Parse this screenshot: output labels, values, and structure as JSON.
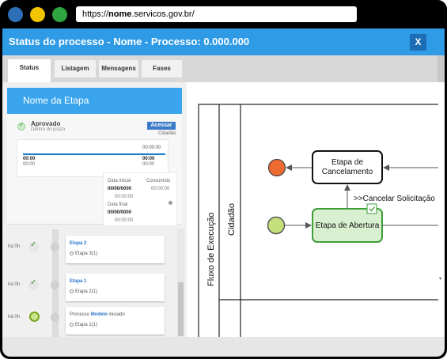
{
  "browser": {
    "url_prefix": "https://",
    "url_domain": "nome",
    "url_suffix": ".servicos.gov.br/"
  },
  "modal": {
    "title": "Status do processo - Nome - Processo: 0.000.000",
    "close_label": "X"
  },
  "tabs": [
    {
      "label": "Status",
      "active": true
    },
    {
      "label": "Listagem",
      "active": false
    },
    {
      "label": "Mensagens",
      "active": false
    },
    {
      "label": "Fases",
      "active": false
    }
  ],
  "stage": {
    "title": "Nome da Etapa",
    "status": "Aprovado",
    "status_detail": "Dentro do prazo",
    "access_button": "Acessar",
    "responsible": "Cidadão",
    "timeline": {
      "top_time": "00:00:00",
      "left_value": "00:00",
      "left_sub": "00:00",
      "right_value": "00:00",
      "right_sub": "00:00"
    },
    "dates": {
      "start_label": "Data inicial",
      "start_value": "00/00/0000",
      "start_time": "00:00:00",
      "consumed_label": "Consumido",
      "consumed_value": "00:00:00",
      "end_label": "Data final",
      "end_value": "00/00/0000",
      "end_time": "00:00:00"
    }
  },
  "history": [
    {
      "time": "há 0h",
      "title": "Etapa 2",
      "sub": "Etapa 3(1)",
      "state": "done"
    },
    {
      "time": "há 0h",
      "title": "Etapa 1",
      "sub": "Etapa 2(1)",
      "state": "done"
    },
    {
      "time": "há 0h",
      "title_prefix": "Processo ",
      "title": "Modelo",
      "title_suffix": " iniciado",
      "sub": "Etapa 1(1)",
      "state": "current"
    }
  ],
  "diagram": {
    "pool_label": "Fluxo de Execução",
    "lane_label": "Cidadão",
    "task_cancel": [
      "Etapa de",
      "Cancelamento"
    ],
    "task_open": "Etapa de Abertura",
    "flow_label": ">>Cancelar Solicitação",
    "colors": {
      "end_event": "#ee6b2f",
      "start_event": "#c5e07a",
      "task_active_fill": "#d8f0cf",
      "task_active_border": "#3f9d3a"
    }
  },
  "colors": {
    "header_blue": "#2f9be6",
    "close_button": "#1d6db5",
    "stage_header": "#3aa5ed"
  }
}
